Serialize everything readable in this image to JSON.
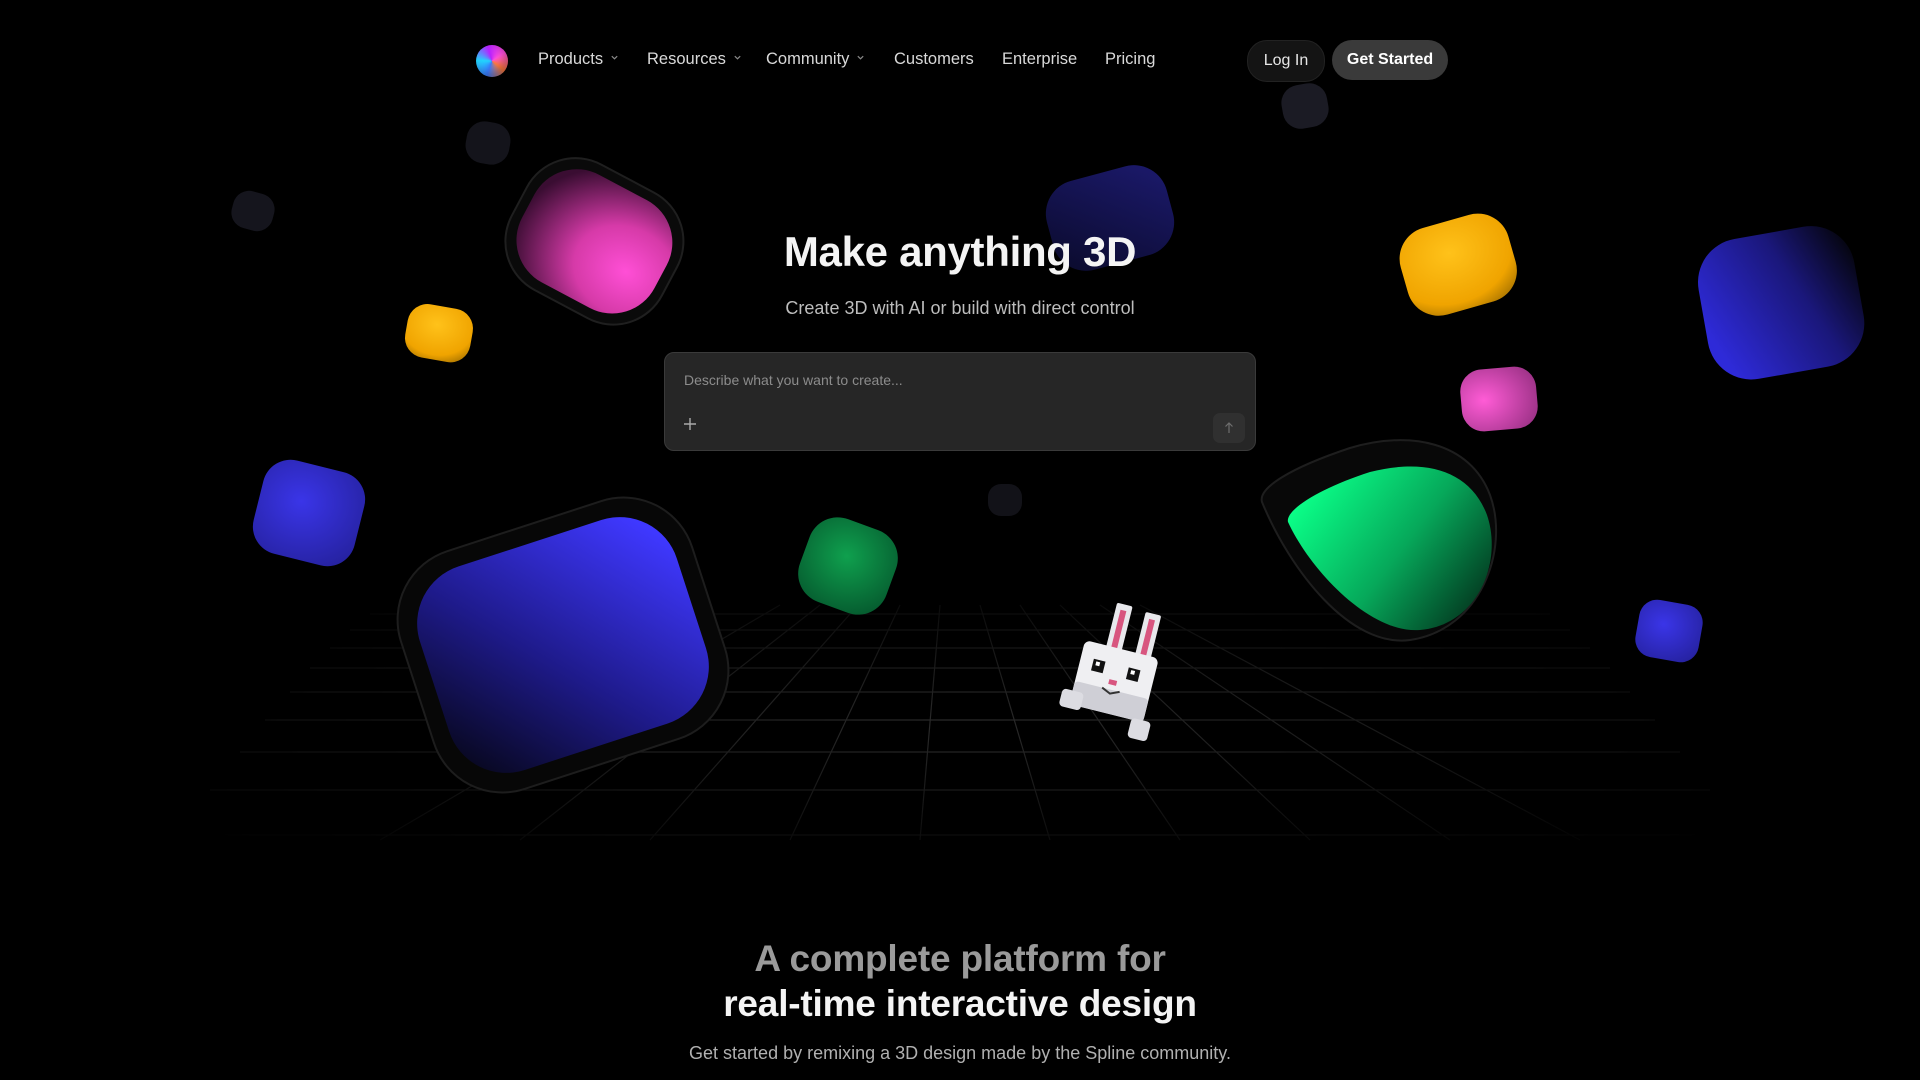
{
  "nav": {
    "items": [
      {
        "label": "Products",
        "has_dropdown": true
      },
      {
        "label": "Resources",
        "has_dropdown": true
      },
      {
        "label": "Community",
        "has_dropdown": true
      },
      {
        "label": "Customers",
        "has_dropdown": false
      },
      {
        "label": "Enterprise",
        "has_dropdown": false
      },
      {
        "label": "Pricing",
        "has_dropdown": false
      }
    ],
    "login_label": "Log In",
    "get_started_label": "Get Started"
  },
  "hero": {
    "title": "Make anything 3D",
    "subtitle": "Create 3D with AI or build with direct control",
    "prompt": {
      "value": "",
      "placeholder": "Describe what you want to create...",
      "add_icon": "plus-icon",
      "send_icon": "arrow-up-icon"
    }
  },
  "platform": {
    "title_line1": "A complete platform for",
    "title_line2": "real-time interactive design",
    "subtitle": "Get started by remixing a 3D design made by the Spline community."
  },
  "colors": {
    "background": "#000000",
    "magenta": "#ff3fd0",
    "blue": "#3b35f0",
    "yellow": "#ffb200",
    "green": "#08e07a",
    "button_dark": "#3a3a3a"
  }
}
